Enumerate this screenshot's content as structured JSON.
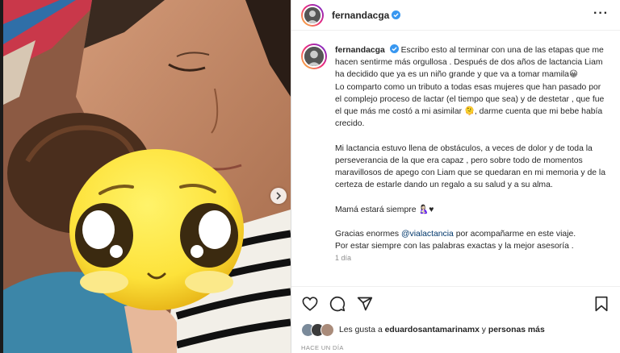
{
  "post": {
    "username": "fernandacga",
    "caption_paragraphs": [
      "Escribo esto al terminar con una de las etapas que me hacen sentirme más orgullosa . Después de dos años de lactancia Liam ha decidido que ya es un niño grande y que va a tomar mamila😀",
      "Lo comparto como un tributo a todas esas mujeres que han pasado por el complejo proceso de lactar (el tiempo que sea) y de destetar , que fue el que más me costó a mi asimilar 🫠, darme cuenta que mi bebe había crecido.",
      "Mi lactancia estuvo llena de obstáculos, a veces de dolor y de toda la perseverancia de la que era capaz , pero sobre todo de momentos maravillosos de apego con Liam que se quedaran en mi memoria y de la certeza de estarle dando un regalo a su salud y a su alma.",
      "Mamá estará siempre 🤱🏻♥"
    ],
    "thanks_prefix": "Gracias enormes ",
    "thanks_mention": "@vialactancia",
    "thanks_suffix": " por acompañarme en este viaje.",
    "thanks_line2": "Por estar siempre con las palabras exactas y la mejor asesoría .",
    "timestamp": "1 día"
  },
  "likes": {
    "prefix": "Les gusta a ",
    "user": "eduardosantamarinamx",
    "middle": " y ",
    "rest": "personas más"
  },
  "time_ago": "HACE UN DÍA",
  "icons": [
    "heart-icon",
    "comment-icon",
    "share-icon",
    "bookmark-icon",
    "more-icon",
    "verified-icon",
    "chevron-right-icon"
  ],
  "colors": {
    "verified": "#3897f0",
    "mention": "#00376b",
    "muted": "#8e8e8e"
  }
}
